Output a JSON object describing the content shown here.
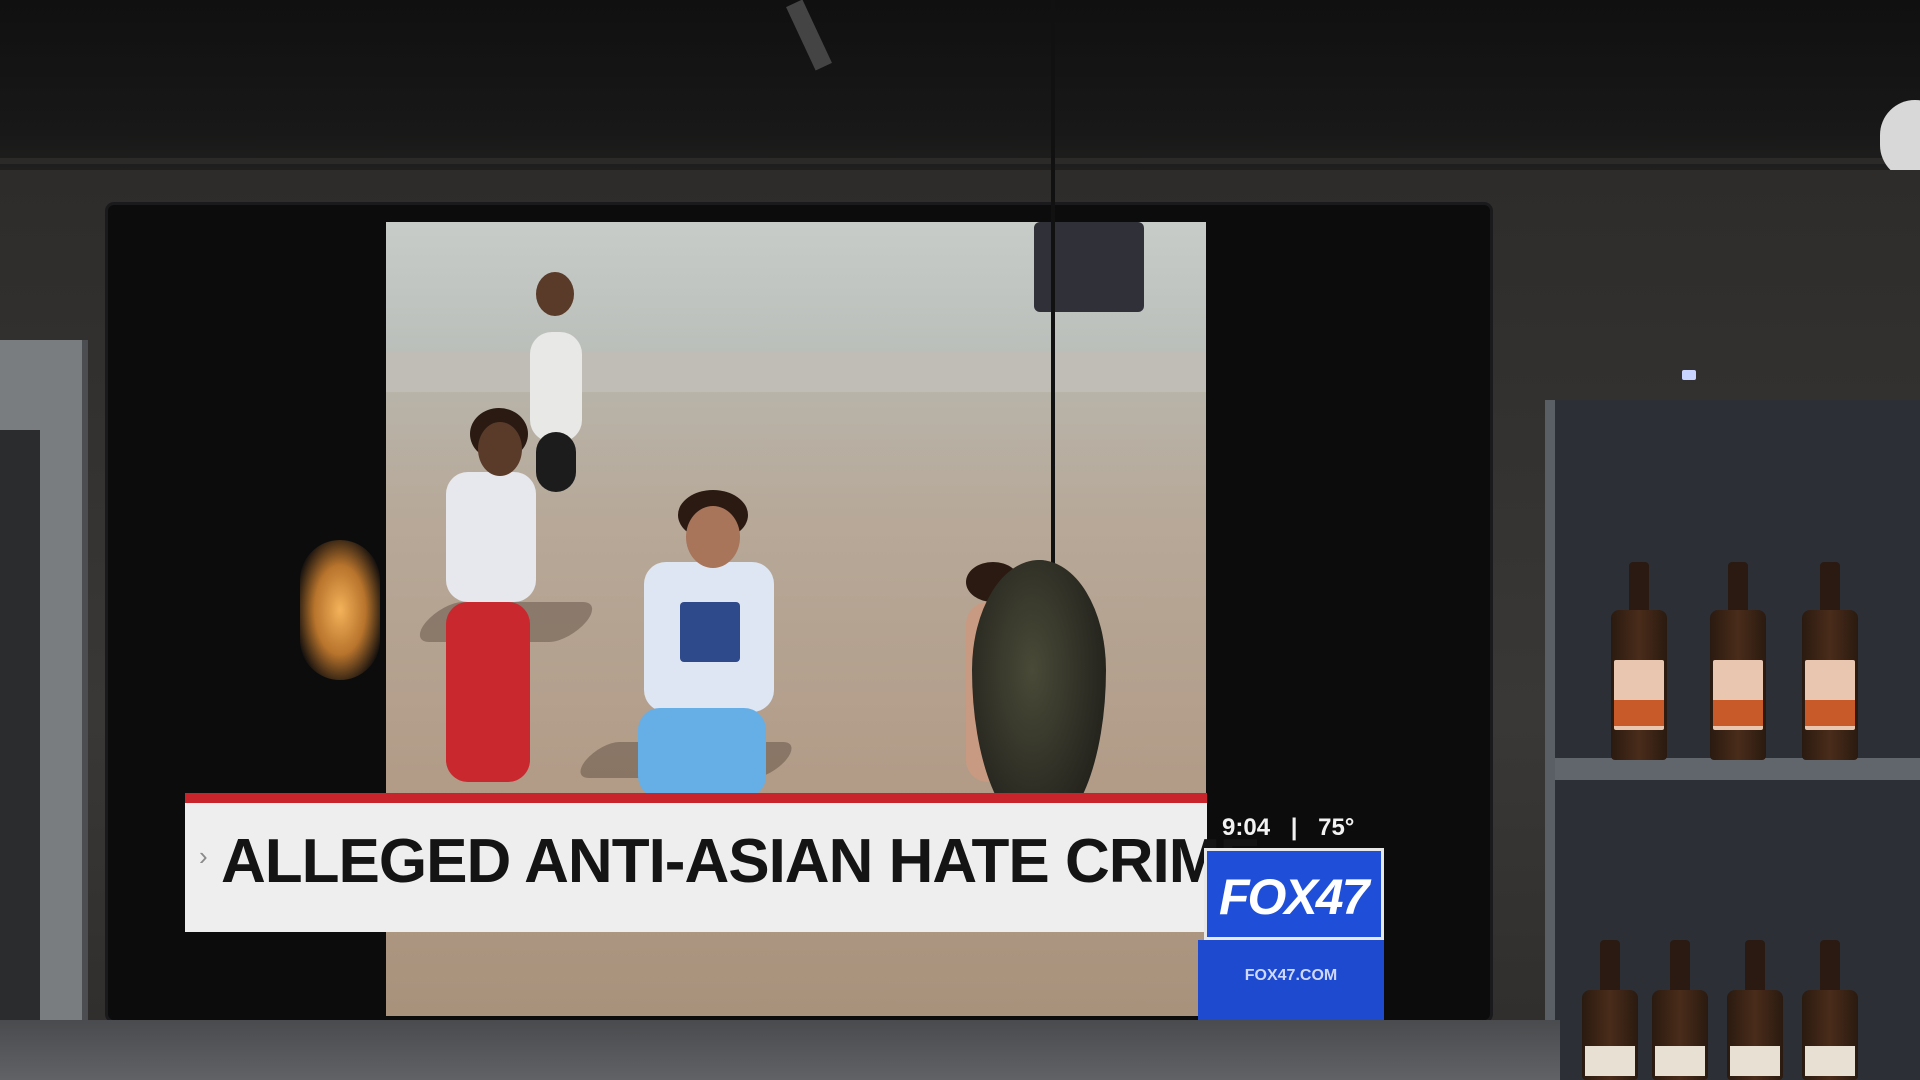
{
  "broadcast": {
    "headline": "ALLEGED ANTI-ASIAN HATE CRIME",
    "chevron": "›",
    "time": "9:04",
    "separator": "|",
    "temperature": "75°",
    "station_logo": "FOX47",
    "station_url": "FOX47.COM"
  },
  "colors": {
    "headline_band": "#eeeeee",
    "accent_red": "#c8242c",
    "station_blue": "#1f4fd8"
  }
}
